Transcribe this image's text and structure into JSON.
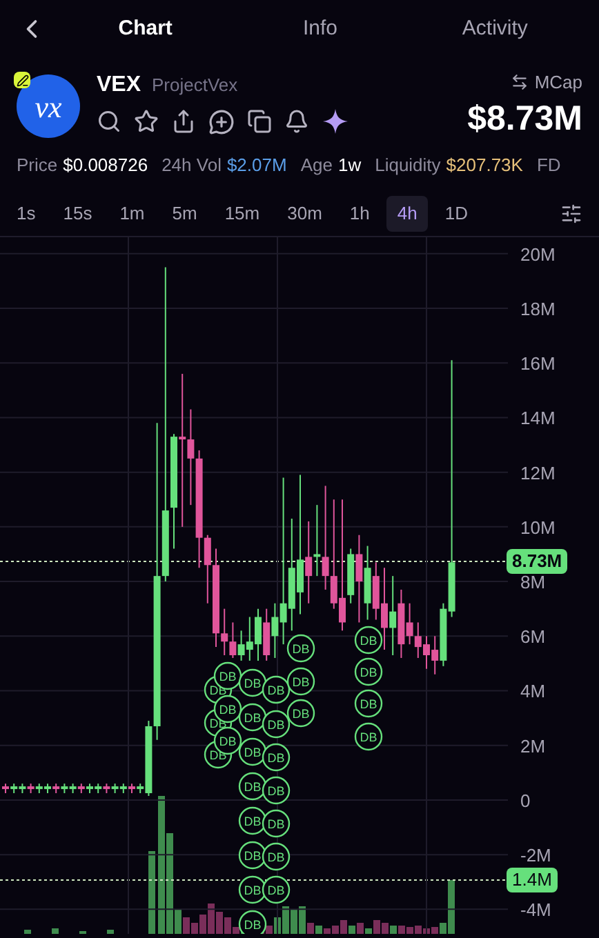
{
  "tabs": [
    {
      "label": "Chart",
      "selected": true
    },
    {
      "label": "Info",
      "selected": false
    },
    {
      "label": "Activity",
      "selected": false
    }
  ],
  "token": {
    "logo_text": "vx",
    "symbol": "VEX",
    "name": "ProjectVex",
    "metric_label": "MCap",
    "metric_value": "$8.73M"
  },
  "stats": [
    {
      "label": "Price",
      "value": "$0.008726",
      "color": "#ffffff"
    },
    {
      "label": "24h Vol",
      "value": "$2.07M",
      "color": "#5b9ee8"
    },
    {
      "label": "Age",
      "value": "1w",
      "color": "#ffffff"
    },
    {
      "label": "Liquidity",
      "value": "$207.73K",
      "color": "#e6c07a"
    },
    {
      "label": "FD"
    }
  ],
  "timeframes": [
    {
      "label": "1s",
      "selected": false
    },
    {
      "label": "15s",
      "selected": false
    },
    {
      "label": "1m",
      "selected": false
    },
    {
      "label": "5m",
      "selected": false
    },
    {
      "label": "15m",
      "selected": false
    },
    {
      "label": "30m",
      "selected": false
    },
    {
      "label": "1h",
      "selected": false
    },
    {
      "label": "4h",
      "selected": true
    },
    {
      "label": "1D",
      "selected": false
    }
  ],
  "chart": {
    "chart_data": {
      "type": "candlestick",
      "grid": true,
      "ylim": [
        -4.9,
        20.6
      ],
      "categories": [
        null,
        null,
        null,
        null,
        null,
        null,
        null,
        null,
        null,
        null,
        null,
        null,
        null,
        null,
        null,
        null,
        null,
        null,
        null,
        null,
        null,
        null,
        null,
        null,
        null,
        null,
        null,
        null,
        null,
        null,
        null,
        null,
        null,
        null,
        null,
        null,
        null,
        null,
        null,
        null,
        null,
        null,
        null,
        null,
        null,
        null,
        null,
        null,
        null,
        null,
        null,
        null,
        null,
        null
      ],
      "ohlc": [
        [
          0.5,
          0.6,
          0.25,
          0.4
        ],
        [
          0.4,
          0.6,
          0.25,
          0.5
        ],
        [
          0.4,
          0.6,
          0.25,
          0.5
        ],
        [
          0.5,
          0.6,
          0.25,
          0.4
        ],
        [
          0.4,
          0.6,
          0.25,
          0.5
        ],
        [
          0.4,
          0.6,
          0.25,
          0.5
        ],
        [
          0.5,
          0.6,
          0.25,
          0.4
        ],
        [
          0.4,
          0.6,
          0.25,
          0.5
        ],
        [
          0.4,
          0.6,
          0.25,
          0.5
        ],
        [
          0.5,
          0.6,
          0.25,
          0.4
        ],
        [
          0.4,
          0.6,
          0.25,
          0.5
        ],
        [
          0.4,
          0.6,
          0.25,
          0.5
        ],
        [
          0.5,
          0.6,
          0.25,
          0.4
        ],
        [
          0.4,
          0.6,
          0.25,
          0.5
        ],
        [
          0.4,
          0.6,
          0.25,
          0.5
        ],
        [
          0.5,
          0.6,
          0.25,
          0.4
        ],
        [
          0.4,
          0.6,
          0.25,
          0.5
        ],
        [
          0.25,
          2.9,
          0.15,
          2.7
        ],
        [
          2.7,
          13.8,
          2.2,
          8.2
        ],
        [
          8.2,
          19.5,
          8.0,
          10.6
        ],
        [
          10.7,
          13.4,
          9.2,
          13.3
        ],
        [
          13.3,
          15.6,
          10.0,
          13.2
        ],
        [
          13.2,
          14.3,
          10.8,
          12.5
        ],
        [
          12.5,
          12.8,
          8.5,
          9.6
        ],
        [
          9.6,
          9.7,
          7.2,
          8.6
        ],
        [
          8.6,
          9.2,
          5.6,
          6.1
        ],
        [
          6.1,
          7.0,
          5.3,
          5.8
        ],
        [
          5.8,
          6.5,
          5.2,
          5.3
        ],
        [
          5.3,
          6.2,
          5.1,
          5.7
        ],
        [
          5.5,
          6.7,
          5.1,
          5.8
        ],
        [
          5.7,
          7.0,
          5.1,
          6.7
        ],
        [
          6.5,
          7.0,
          5.1,
          5.3
        ],
        [
          6.0,
          7.2,
          5.2,
          6.7
        ],
        [
          6.5,
          11.8,
          5.7,
          7.2
        ],
        [
          7.0,
          10.3,
          6.2,
          8.5
        ],
        [
          7.6,
          11.9,
          6.8,
          8.8
        ],
        [
          8.9,
          10.2,
          7.2,
          8.2
        ],
        [
          8.9,
          10.8,
          8.2,
          9.0
        ],
        [
          8.9,
          11.5,
          7.7,
          8.2
        ],
        [
          8.2,
          11.0,
          7.0,
          7.2
        ],
        [
          7.4,
          11.0,
          6.2,
          6.5
        ],
        [
          7.5,
          9.2,
          7.2,
          9.0
        ],
        [
          9.0,
          9.7,
          6.5,
          8.0
        ],
        [
          7.2,
          9.3,
          6.6,
          8.5
        ],
        [
          8.2,
          8.7,
          6.6,
          7.0
        ],
        [
          7.2,
          8.5,
          5.5,
          6.3
        ],
        [
          6.3,
          8.2,
          5.3,
          6.9
        ],
        [
          7.2,
          7.7,
          5.2,
          5.7
        ],
        [
          6.5,
          7.2,
          5.7,
          6.0
        ],
        [
          6.0,
          6.5,
          5.2,
          5.6
        ],
        [
          5.7,
          6.0,
          4.8,
          5.3
        ],
        [
          5.5,
          6.0,
          4.6,
          5.1
        ],
        [
          5.1,
          7.2,
          4.9,
          7.0
        ],
        [
          6.9,
          16.1,
          6.7,
          8.7
        ]
      ],
      "yticks": [
        {
          "value": 20,
          "label": "20M"
        },
        {
          "value": 18,
          "label": "18M"
        },
        {
          "value": 16,
          "label": "16M"
        },
        {
          "value": 14,
          "label": "14M"
        },
        {
          "value": 12,
          "label": "12M"
        },
        {
          "value": 10,
          "label": "10M"
        },
        {
          "value": 8,
          "label": "8M"
        },
        {
          "value": 6,
          "label": "6M"
        },
        {
          "value": 4,
          "label": "4M"
        },
        {
          "value": 2,
          "label": "2M"
        },
        {
          "value": 0,
          "label": "0"
        },
        {
          "value": -2,
          "label": "-2M"
        },
        {
          "value": -4,
          "label": "-4M"
        }
      ]
    },
    "price_tag": "8.73M",
    "volume_tag": "1.4M",
    "markers": [
      "DB",
      "DB",
      "DB",
      "DB",
      "DB",
      "DB",
      "DB",
      "DB",
      "DB",
      "DB",
      "DB",
      "DB",
      "DB",
      "DB",
      "DB",
      "DB",
      "DB",
      "DB",
      "DB",
      "DB",
      "DB",
      "DB",
      "DB",
      "DB",
      "DB",
      "DB",
      "DB",
      "DB"
    ]
  }
}
